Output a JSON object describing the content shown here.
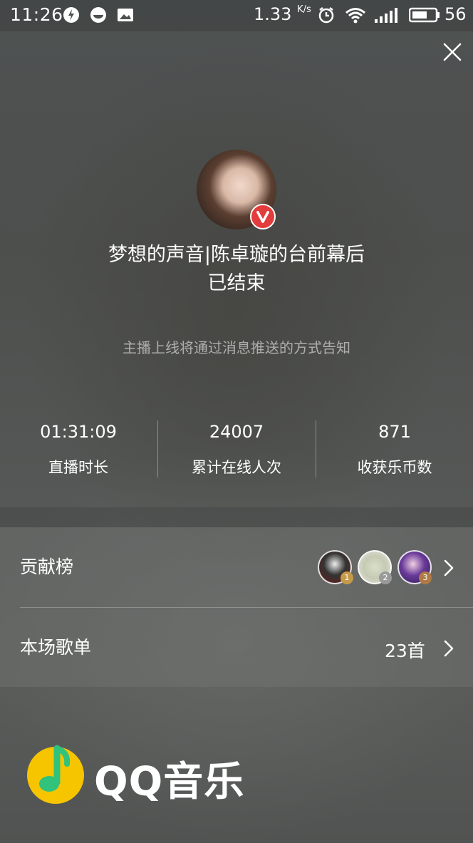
{
  "statusbar": {
    "time": "11:26",
    "speed": "1.33",
    "speed_unit": "K/s",
    "battery": "56"
  },
  "header": {
    "close_icon": "close-icon"
  },
  "host": {
    "title": "梦想的声音|陈卓璇的台前幕后",
    "status": "已结束",
    "badge_icon": "v-verified-icon",
    "badge_color": "#e33c3c"
  },
  "notice": "主播上线将通过消息推送的方式告知",
  "stats": [
    {
      "value": "01:31:09",
      "label": "直播时长"
    },
    {
      "value": "24007",
      "label": "累计在线人次"
    },
    {
      "value": "871",
      "label": "收获乐币数"
    }
  ],
  "contributors": {
    "label": "贡献榜",
    "ranks": [
      "1",
      "2",
      "3"
    ],
    "rank_colors": [
      "#c79a4a",
      "#9a9a9a",
      "#b07a45"
    ]
  },
  "playlist": {
    "label": "本场歌单",
    "count": "23首"
  },
  "logo": {
    "text": "QQ音乐",
    "brand_yellow": "#f6c500",
    "brand_green": "#31c27c"
  }
}
